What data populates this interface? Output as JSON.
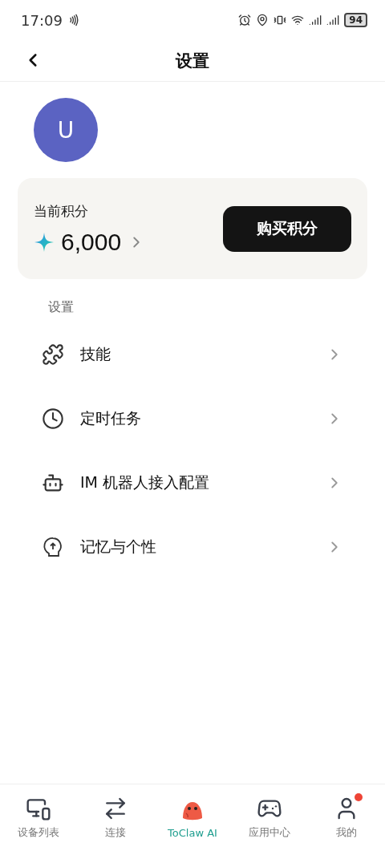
{
  "status_bar": {
    "time": "17:09",
    "battery": "94"
  },
  "header": {
    "title": "设置"
  },
  "profile": {
    "avatar_letter": "U"
  },
  "points": {
    "label": "当前积分",
    "value": "6,000",
    "button": "购买积分"
  },
  "section": {
    "title": "设置"
  },
  "items": [
    {
      "kind": "skills",
      "label": "技能"
    },
    {
      "kind": "schedule",
      "label": "定时任务"
    },
    {
      "kind": "bot",
      "label": "IM 机器人接入配置"
    },
    {
      "kind": "memory",
      "label": "记忆与个性"
    }
  ],
  "tabs": [
    {
      "kind": "devices",
      "label": "设备列表",
      "selected": false,
      "badge": false
    },
    {
      "kind": "connect",
      "label": "连接",
      "selected": false,
      "badge": false
    },
    {
      "kind": "mascot",
      "label": "ToClaw AI",
      "selected": true,
      "badge": false
    },
    {
      "kind": "apps",
      "label": "应用中心",
      "selected": false,
      "badge": false
    },
    {
      "kind": "me",
      "label": "我的",
      "selected": false,
      "badge": true
    }
  ]
}
